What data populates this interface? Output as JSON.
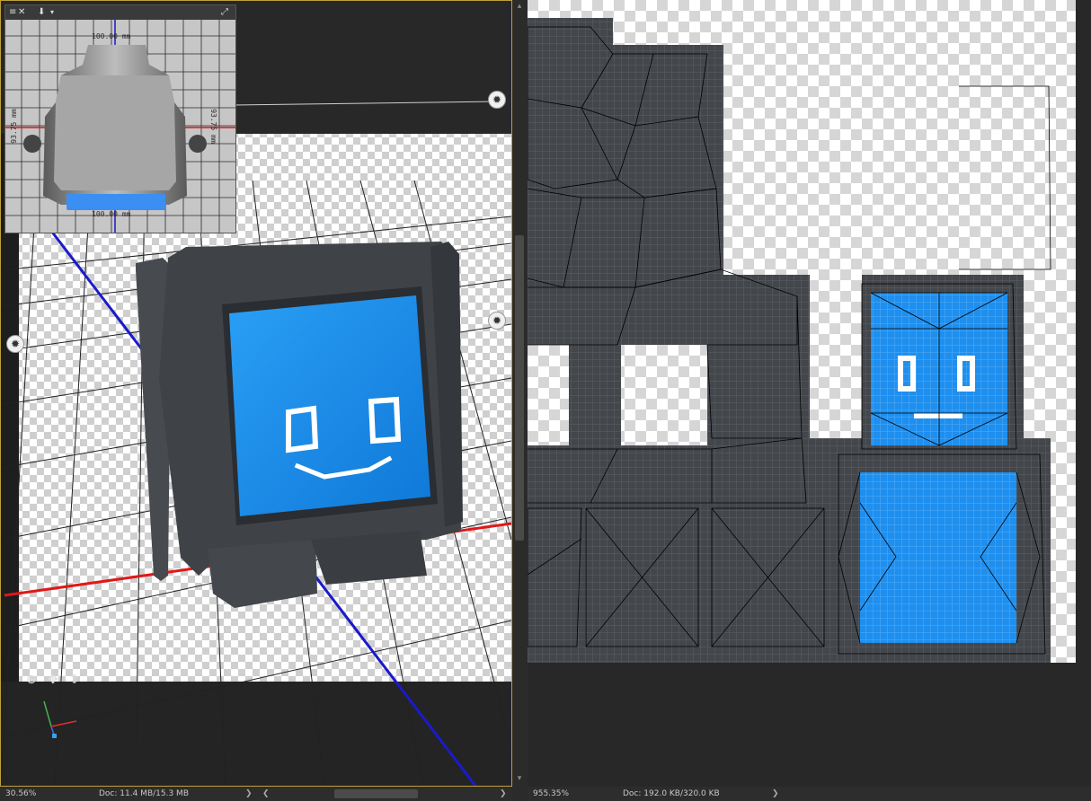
{
  "left_panel": {
    "status": {
      "zoom": "30.56%",
      "doc": "Doc: 11.4 MB/15.3 MB",
      "arrow": "❯",
      "arrow_left": "❮",
      "arrow_right": "❯"
    },
    "minimap": {
      "dimension_top": "100.00 mm",
      "dimension_bottom": "100.00 mm",
      "dimension_left": "93.75 mm",
      "dimension_right": "93.75 mm",
      "icons": {
        "menu": "menu-icon",
        "close": "close-icon",
        "camera_view": "camera-view-icon",
        "dropdown": "dropdown-icon",
        "expand": "expand-icon"
      }
    },
    "tools": [
      "orbit-icon",
      "pan-icon",
      "slide-icon"
    ],
    "lights": [
      "light-icon",
      "light-icon",
      "light-icon"
    ]
  },
  "right_panel": {
    "status": {
      "zoom": "955.35%",
      "doc": "Doc: 192.0 KB/320.0 KB",
      "arrow": "❯"
    }
  },
  "glyphs": {
    "close": "✕",
    "menu": "≡",
    "camera": "⬇",
    "dropdown": "▾",
    "expand": "⤢",
    "light": "✹",
    "orbit": "⊕",
    "pan": "✥",
    "slide": "⇕",
    "up": "▴",
    "down": "▾"
  },
  "colors": {
    "accent_blue": "#1e8fef",
    "mesh_gray": "#3f4247",
    "axis_red": "#e01818",
    "axis_blue": "#1a1acc",
    "selection_border": "#bfa03a"
  }
}
